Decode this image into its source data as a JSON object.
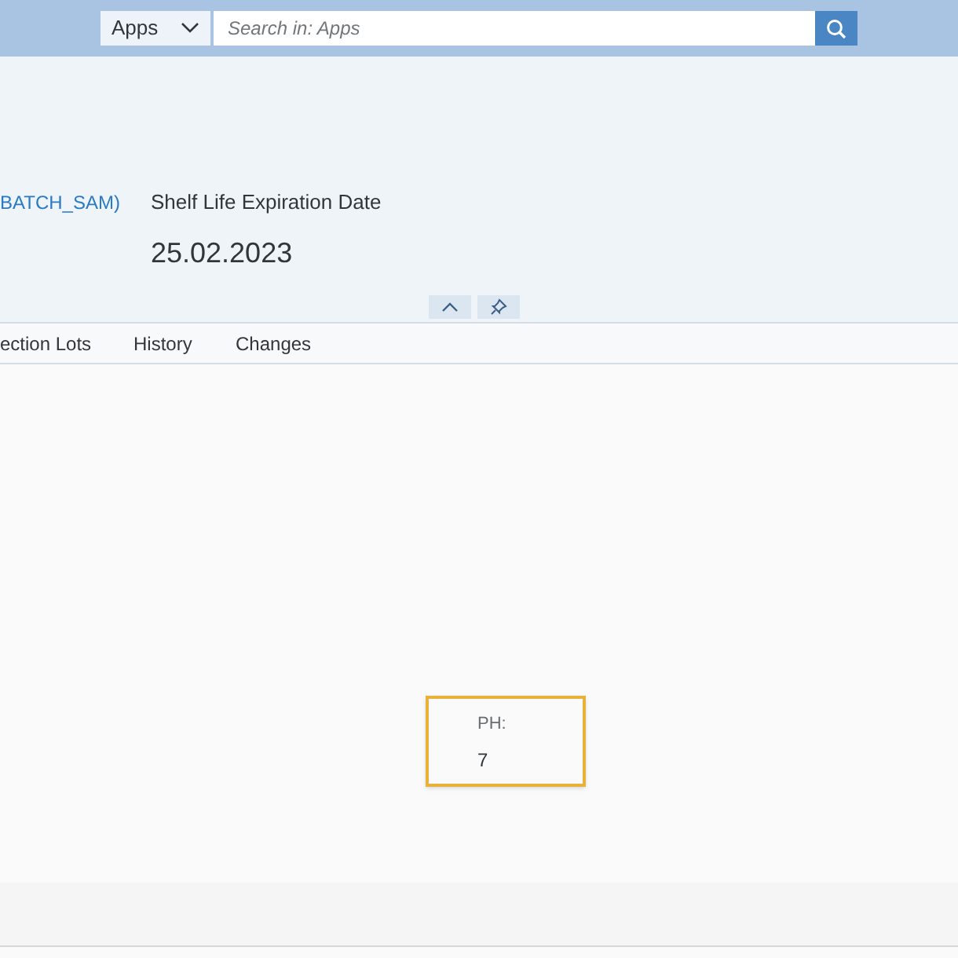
{
  "search": {
    "scope": "Apps",
    "placeholder": "Search in: Apps"
  },
  "header": {
    "link": "BATCH_SAM)",
    "field_label": "Shelf Life Expiration Date",
    "field_value": "25.02.2023"
  },
  "tabs": [
    {
      "label": "ection Lots",
      "selected": false
    },
    {
      "label": "History",
      "selected": false
    },
    {
      "label": "Changes",
      "selected": false
    }
  ],
  "card": {
    "label": "PH:",
    "value": "7"
  }
}
